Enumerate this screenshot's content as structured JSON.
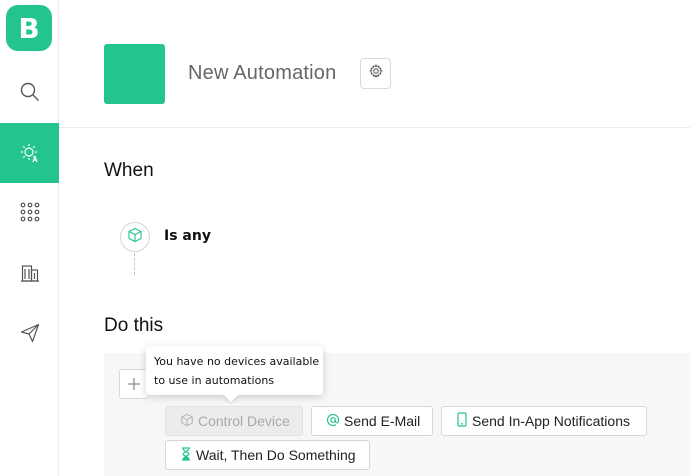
{
  "sidebar": {
    "logo_letter": "B",
    "items": [
      {
        "icon": "search-icon"
      },
      {
        "icon": "automation-icon",
        "active": true
      },
      {
        "icon": "apps-grid-icon"
      },
      {
        "icon": "building-icon"
      },
      {
        "icon": "send-icon"
      }
    ]
  },
  "header": {
    "automation_name": "New Automation"
  },
  "when": {
    "title": "When",
    "condition_label": "Is any"
  },
  "do_this": {
    "title": "Do this",
    "tooltip_line1": "You have no devices available",
    "tooltip_line2": "to use in automations",
    "actions": [
      {
        "label": "Control Device",
        "disabled": true,
        "icon": "cube-icon"
      },
      {
        "label": "Send E-Mail",
        "disabled": false,
        "icon": "at-sign-icon"
      },
      {
        "label": "Send In-App Notifications",
        "disabled": false,
        "icon": "phone-icon"
      },
      {
        "label": "Wait, Then Do Something",
        "disabled": false,
        "icon": "hourglass-icon"
      }
    ]
  },
  "colors": {
    "accent": "#23c48e"
  }
}
